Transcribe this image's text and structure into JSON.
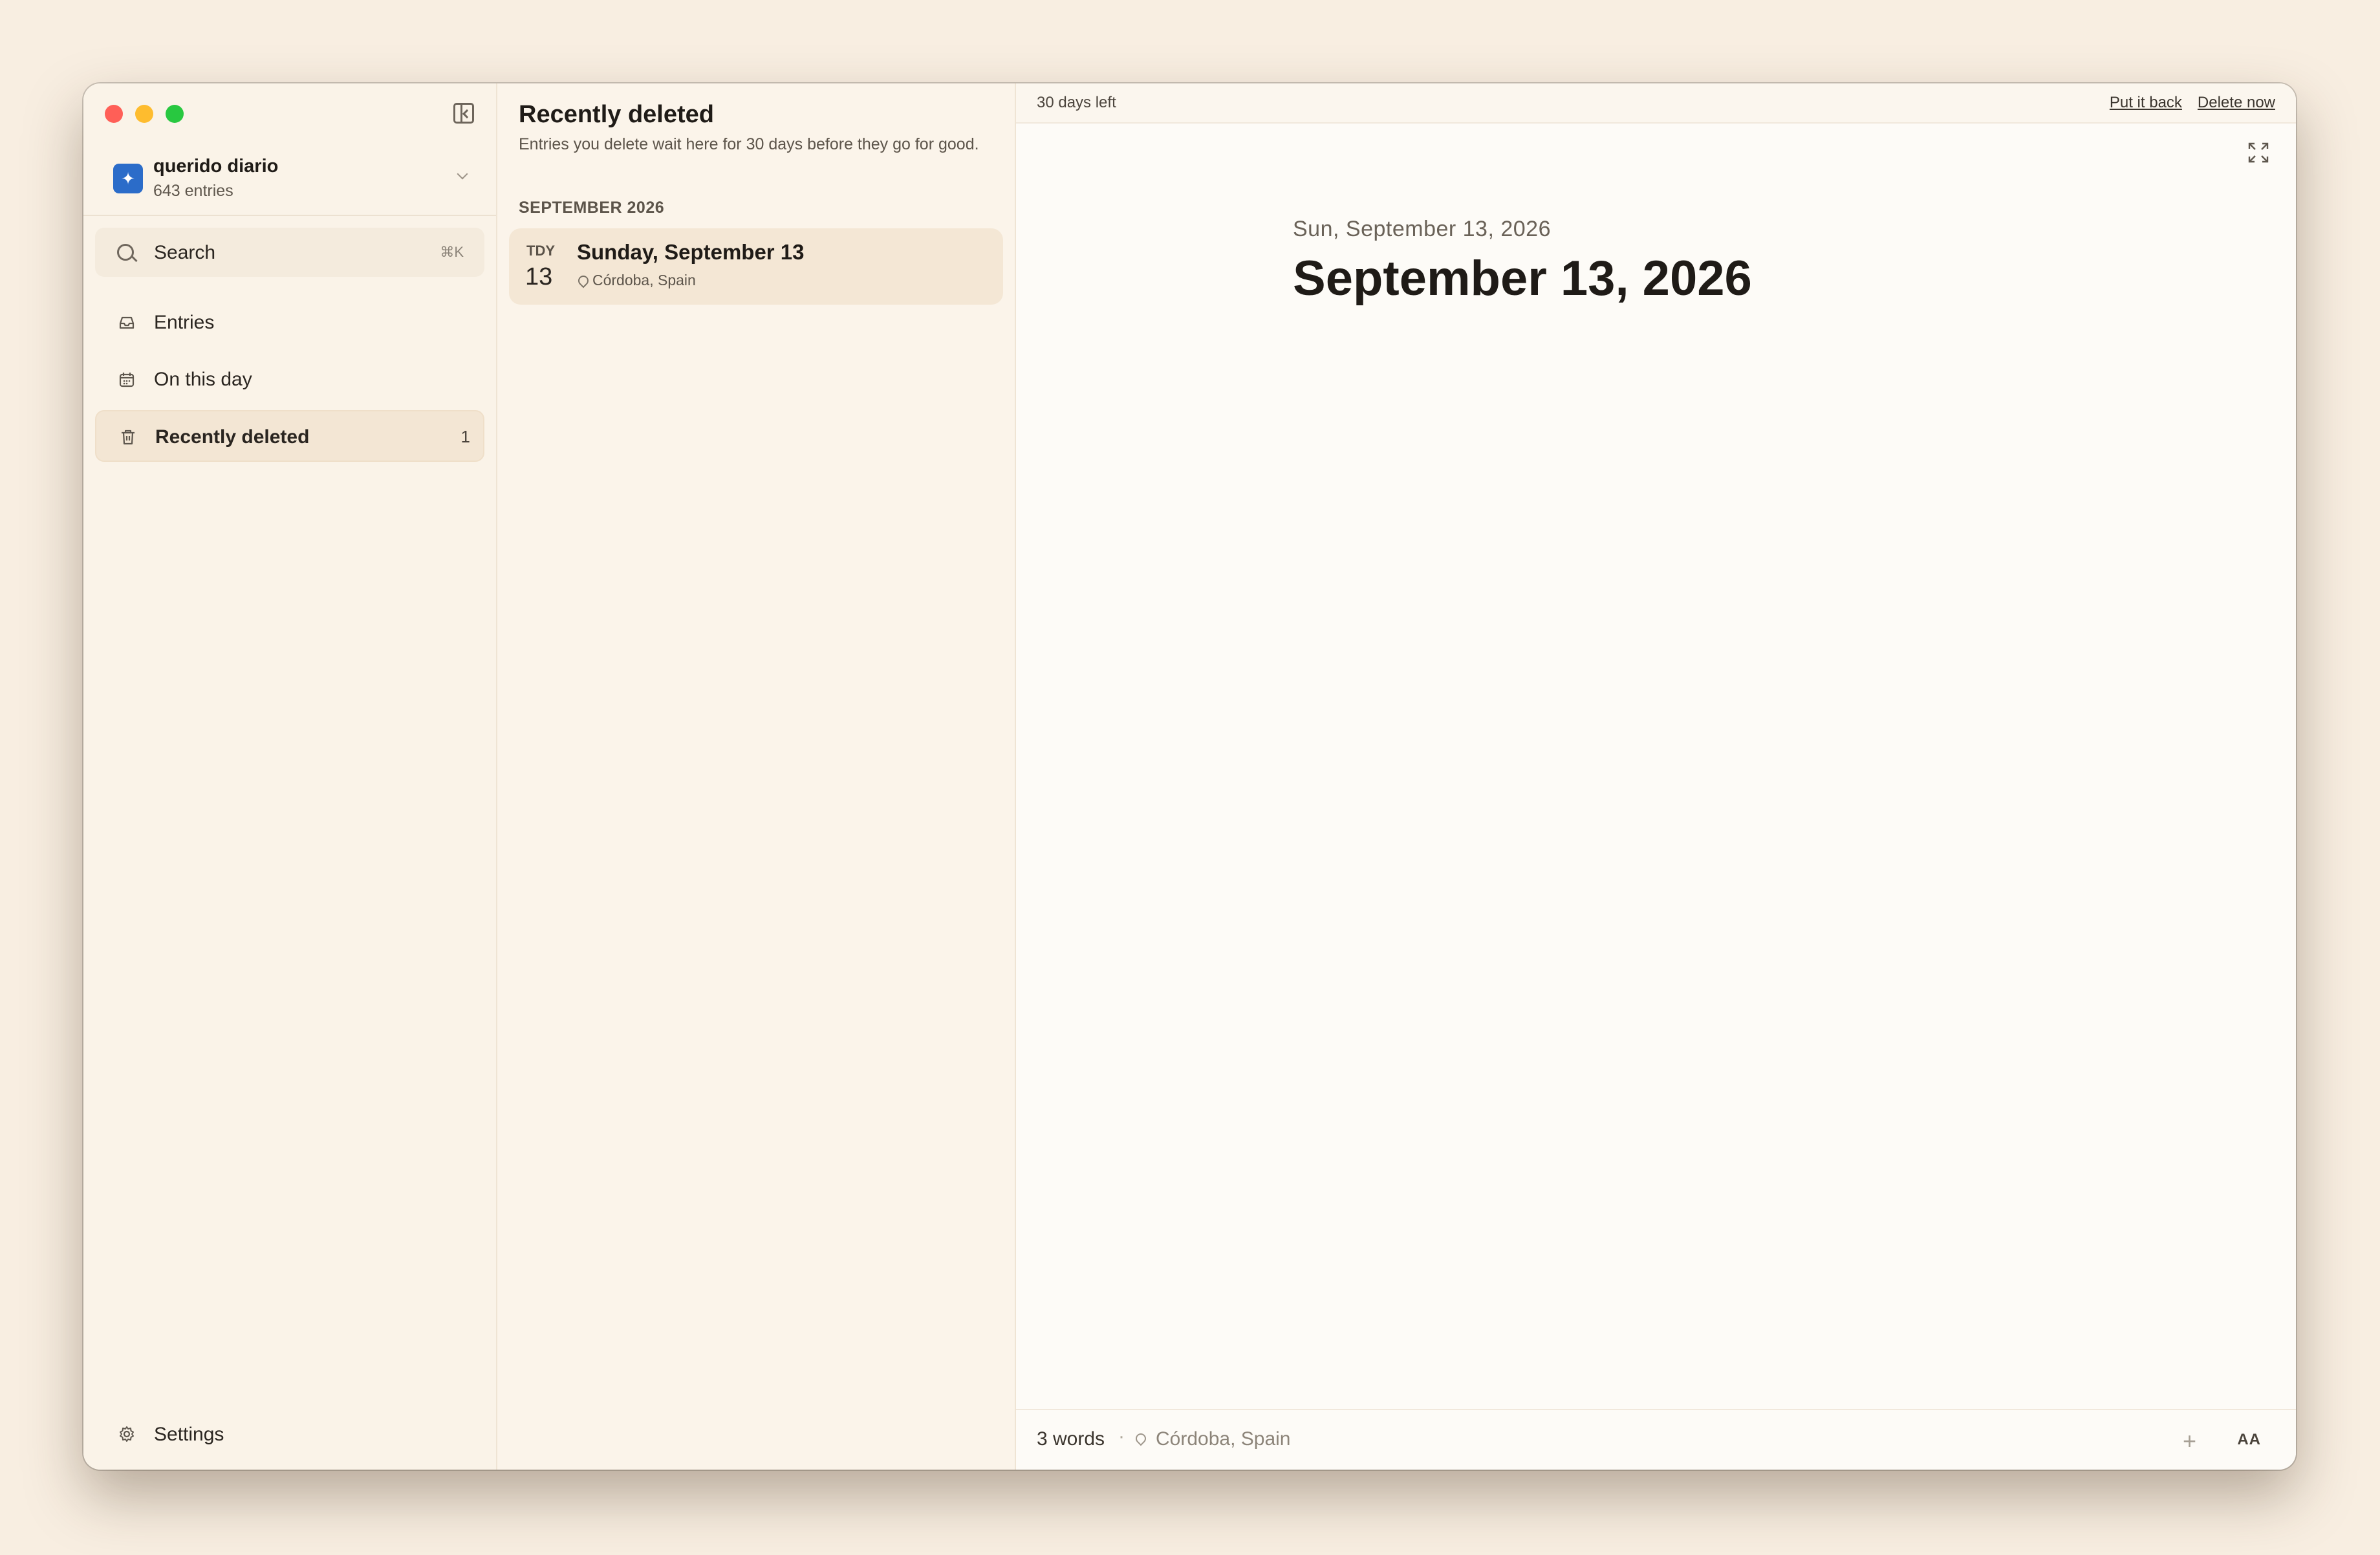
{
  "sidebar": {
    "journal": {
      "icon": "✦",
      "name": "querido diario",
      "count": "643 entries"
    },
    "search": {
      "label": "Search",
      "shortcut": "⌘K"
    },
    "nav": [
      {
        "label": "Entries",
        "icon": "inbox-icon"
      },
      {
        "label": "On this day",
        "icon": "calendar-icon"
      },
      {
        "label": "Recently deleted",
        "icon": "trash-icon",
        "badge": "1",
        "active": true
      }
    ],
    "settings_label": "Settings"
  },
  "list": {
    "title": "Recently deleted",
    "subtitle": "Entries you delete wait here for 30 days before they go for good.",
    "group": "SEPTEMBER 2026",
    "entries": [
      {
        "day_abbr": "TDY",
        "day_num": "13",
        "title": "Sunday, September 13",
        "location": "Córdoba, Spain"
      }
    ]
  },
  "editor": {
    "days_left": "30 days left",
    "put_back": "Put it back",
    "delete_now": "Delete now",
    "date_sub": "Sun, September 13, 2026",
    "date_title": "September 13, 2026",
    "word_count": "3 words",
    "separator": "·",
    "location": "Córdoba, Spain",
    "plus": "+",
    "text_size": "AA"
  },
  "colors": {
    "background": "#f8eee1",
    "accent": "#2b6cc9",
    "traffic_red": "#ff5f57",
    "traffic_yellow": "#febc2e",
    "traffic_green": "#28c840"
  }
}
